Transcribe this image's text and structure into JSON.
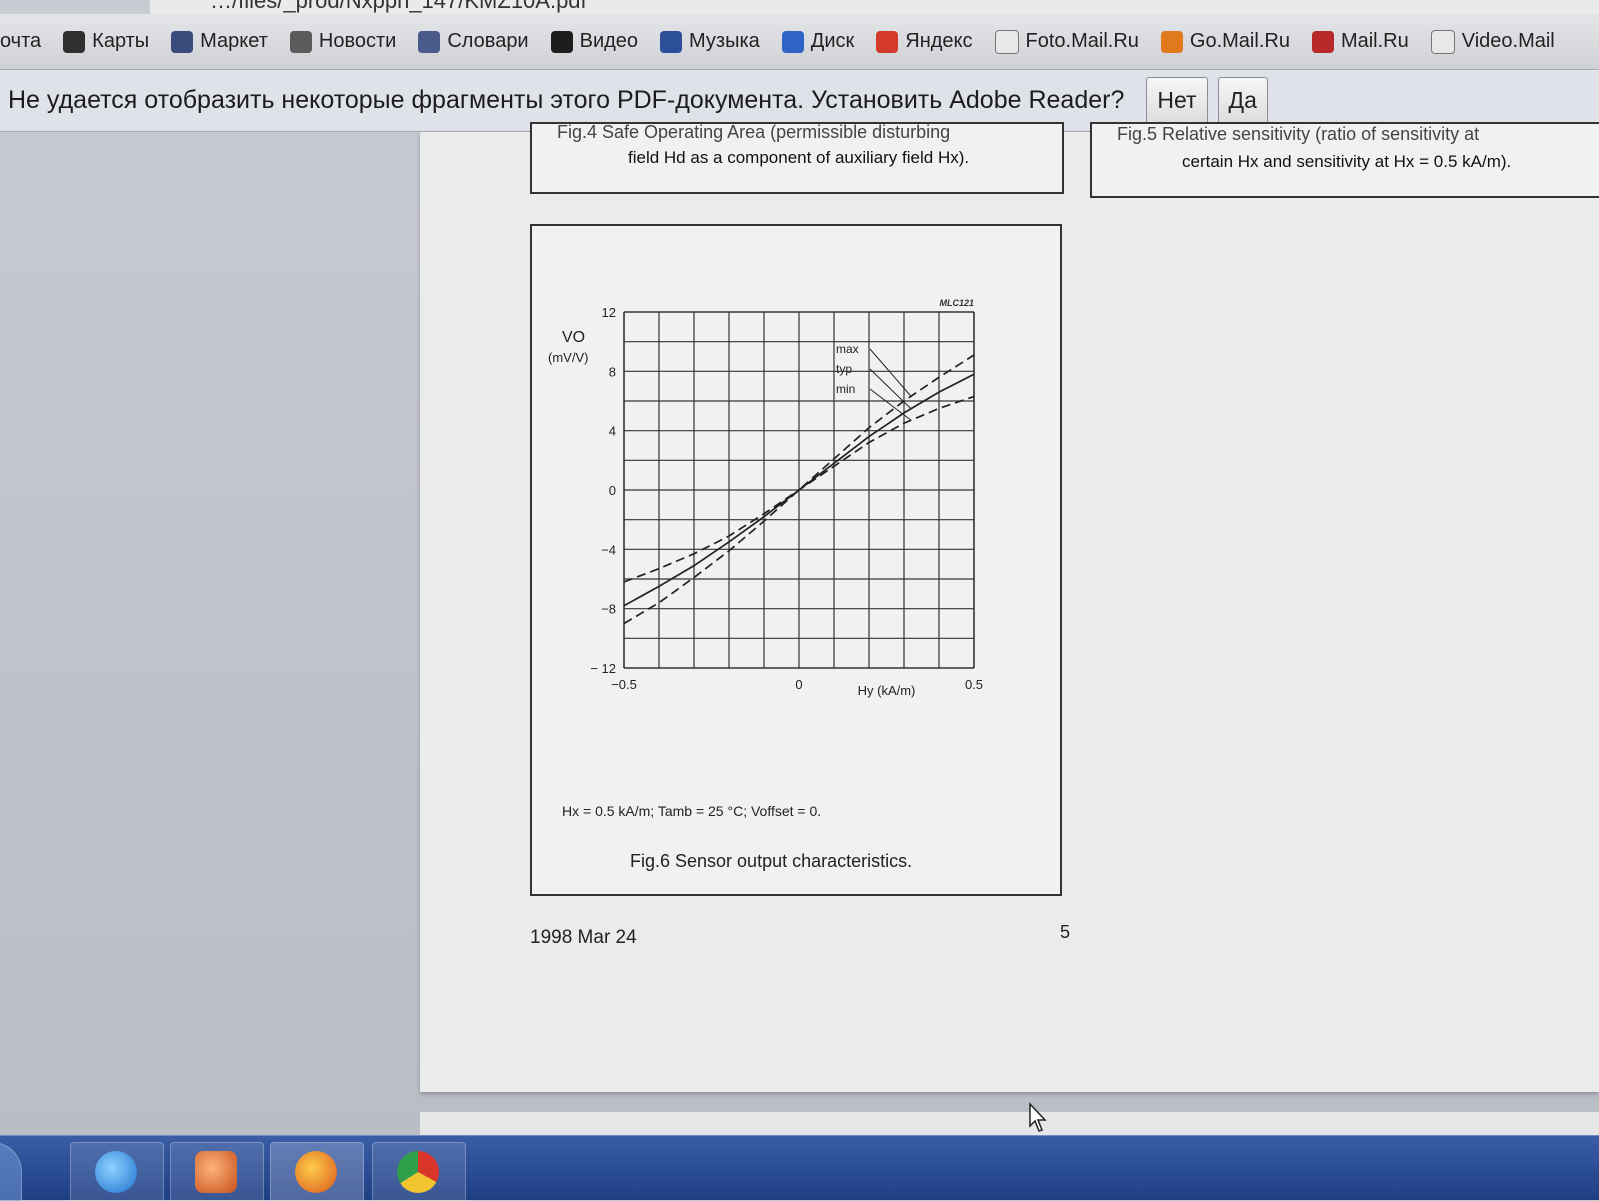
{
  "browser": {
    "url": "…/files/_prod/Nxppn_147/KMZ10A.pdf",
    "bookmarks": [
      {
        "label": "очта",
        "icon": "mail-icon",
        "color": ""
      },
      {
        "label": "Карты",
        "icon": "maps-icon",
        "color": "#2f2f2f"
      },
      {
        "label": "Маркет",
        "icon": "market-icon",
        "color": "#3a4a7a"
      },
      {
        "label": "Новости",
        "icon": "news-icon",
        "color": "#5b5b5b"
      },
      {
        "label": "Словари",
        "icon": "dictionary-icon",
        "color": "#4a5a8a"
      },
      {
        "label": "Видео",
        "icon": "video-icon",
        "color": "#1d1d1d"
      },
      {
        "label": "Музыка",
        "icon": "music-icon",
        "color": "#2d4f9a"
      },
      {
        "label": "Диск",
        "icon": "disk-icon",
        "color": "#2e64c8"
      },
      {
        "label": "Яндекс",
        "icon": "yandex-icon",
        "color": "#d43a2c"
      },
      {
        "label": "Foto.Mail.Ru",
        "icon": "page-icon",
        "color": "#e8e8e8"
      },
      {
        "label": "Go.Mail.Ru",
        "icon": "go-mail-icon",
        "color": "#e07a1c"
      },
      {
        "label": "Mail.Ru",
        "icon": "mailru-icon",
        "color": "#b8282a"
      },
      {
        "label": "Video.Mail",
        "icon": "page-icon",
        "color": "#e8e8e8"
      }
    ]
  },
  "infobar": {
    "message": "Не удается отобразить некоторые фрагменты этого PDF-документа. Установить Adobe Reader?",
    "no_label": "Нет",
    "yes_label": "Да"
  },
  "pdf": {
    "fig4_cut": "Fig.4    Safe Operating Area (permissible disturbing",
    "fig4_line2": "field Hd as a component of auxiliary field Hx).",
    "fig5_cut": "Fig.5    Relative sensitivity (ratio of sensitivity at",
    "fig5_line2": "certain Hx and sensitivity at Hx = 0.5 kA/m).",
    "fig6_conditions": "Hx = 0.5 kA/m; Tamb = 25 °C; Voffset = 0.",
    "fig6_caption": "Fig.6  Sensor output characteristics.",
    "date": "1998 Mar 24",
    "page_number": "5"
  },
  "chart_data": {
    "type": "line",
    "code": "MLC121",
    "ylabel": "VO",
    "yunit": "(mV/V)",
    "xlabel": "Hy (kA/m)",
    "xlim": [
      -0.5,
      0.5
    ],
    "ylim": [
      -12,
      12
    ],
    "x_ticks": [
      -0.5,
      0,
      0.5
    ],
    "x_tick_labels": [
      "−0.5",
      "0",
      "0.5"
    ],
    "y_ticks": [
      12,
      8,
      4,
      0,
      -4,
      -8,
      -12
    ],
    "y_tick_labels": [
      "12",
      "8",
      "4",
      "0",
      "−4",
      "−8",
      "− 12"
    ],
    "grid": true,
    "grid_cols": 10,
    "grid_rows": 12,
    "series": [
      {
        "name": "max",
        "style": "dashed",
        "x": [
          -0.5,
          -0.4,
          -0.3,
          -0.2,
          -0.1,
          0,
          0.1,
          0.2,
          0.3,
          0.4,
          0.5
        ],
        "y": [
          -9.0,
          -7.6,
          -5.9,
          -4.1,
          -2.1,
          0,
          2.1,
          4.2,
          6.0,
          7.6,
          9.1
        ]
      },
      {
        "name": "typ",
        "style": "solid",
        "x": [
          -0.5,
          -0.4,
          -0.3,
          -0.2,
          -0.1,
          0,
          0.1,
          0.2,
          0.3,
          0.4,
          0.5
        ],
        "y": [
          -7.8,
          -6.5,
          -5.1,
          -3.5,
          -1.8,
          0,
          1.8,
          3.6,
          5.2,
          6.6,
          7.8
        ]
      },
      {
        "name": "min",
        "style": "dashed",
        "x": [
          -0.5,
          -0.4,
          -0.3,
          -0.2,
          -0.1,
          0,
          0.1,
          0.2,
          0.3,
          0.4,
          0.5
        ],
        "y": [
          -6.2,
          -5.3,
          -4.3,
          -3.1,
          -1.6,
          0,
          1.6,
          3.2,
          4.5,
          5.5,
          6.3
        ]
      }
    ]
  }
}
